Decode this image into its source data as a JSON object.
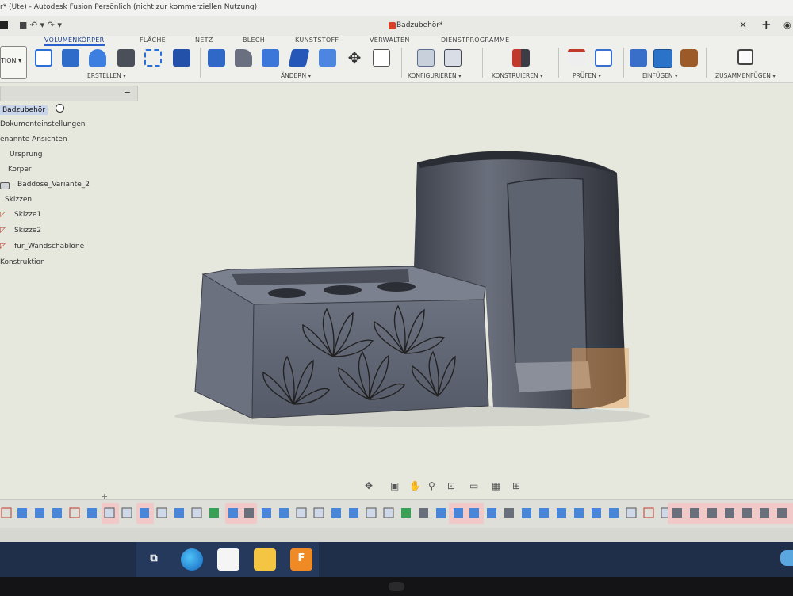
{
  "window": {
    "title": "r* (Ute) - Autodesk Fusion Persönlich (nicht zur kommerziellen Nutzung)",
    "document_tab": "Badzubehör*",
    "tab_close": "×",
    "new_tab": "+",
    "quick_access": "■   ↶ ▾   ↷ ▾"
  },
  "ribbon": {
    "workspace": "TION ▾",
    "tabs": [
      "VOLUMENKÖRPER",
      "FLÄCHE",
      "NETZ",
      "BLECH",
      "KUNSTSTOFF",
      "VERWALTEN",
      "DIENSTPROGRAMME"
    ],
    "active_tab": "VOLUMENKÖRPER",
    "groups": [
      "ERSTELLEN ▾",
      "ÄNDERN ▾",
      "KONFIGURIEREN ▾",
      "KONSTRUIEREN ▾",
      "PRÜFEN ▾",
      "EINFÜGEN ▾",
      "ZUSAMMENFÜGEN ▾"
    ]
  },
  "browser": {
    "collapse": "−",
    "items": [
      "Badzubehör",
      "Dokumenteinstellungen",
      "enannte Ansichten",
      "Ursprung",
      "Körper",
      "Baddose_Variante_2",
      "Skizzen",
      "Skizze1",
      "Skizze2",
      "für_Wandschablone",
      "Konstruktion"
    ]
  },
  "colors": {
    "accent": "#2a5fcf",
    "viewport_bg": "#e6e8de",
    "model_body": "#5d6270",
    "model_dark": "#30323a",
    "selection_highlight": "#f0a050",
    "taskbar": "#1f2f4a"
  },
  "icons": {
    "navigation": [
      "orbit-icon",
      "look-at-icon",
      "pan-icon",
      "zoom-icon",
      "fit-icon",
      "display-settings-icon",
      "grid-icon",
      "viewports-icon"
    ],
    "taskbar": [
      "task-view-icon",
      "edge-icon",
      "store-icon",
      "explorer-icon",
      "fusion-icon"
    ]
  },
  "taskbar": {
    "fusion_label": "F"
  }
}
